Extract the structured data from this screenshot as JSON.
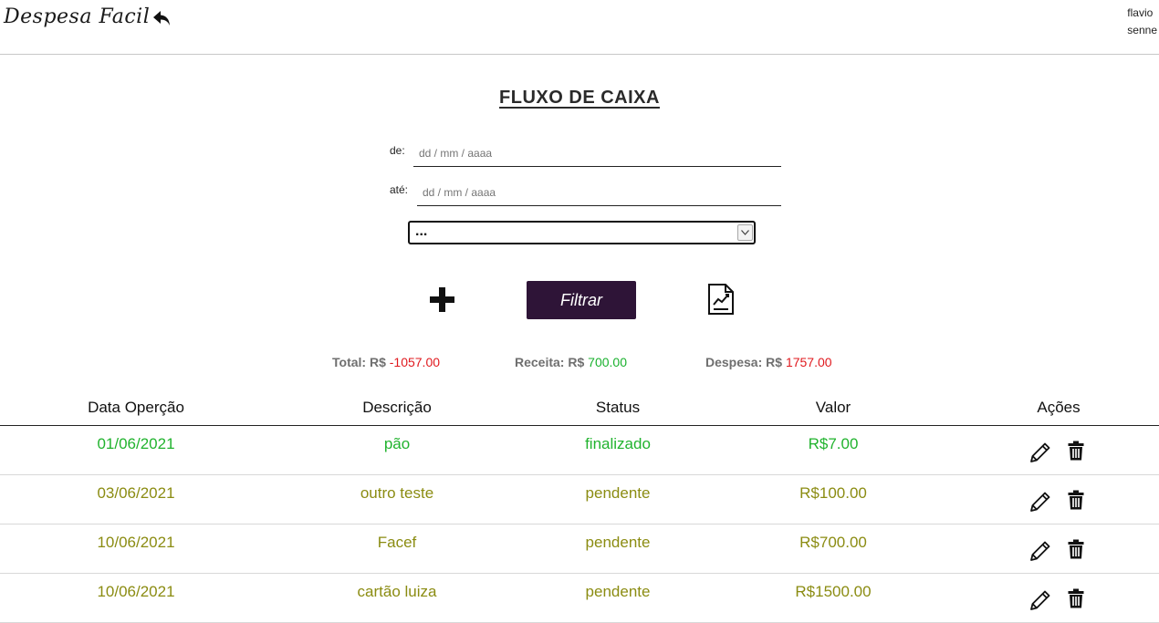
{
  "app": {
    "title": "Despesa Facil",
    "back_icon": "reply-arrow-icon"
  },
  "user": {
    "first_name": "flavio",
    "last_name": "senne"
  },
  "page": {
    "title": "FLUXO DE CAIXA"
  },
  "filters": {
    "from_label": "de:",
    "from_placeholder": "dd / mm / aaaa",
    "to_label": "até:",
    "to_placeholder": "dd / mm / aaaa",
    "select_value": "...",
    "select_icon": "chevron-down-icon"
  },
  "actions": {
    "add_icon": "plus-icon",
    "filter_label": "Filtrar",
    "report_icon": "report-chart-icon"
  },
  "totals": {
    "total_label": "Total: R$",
    "total_value": "-1057.00",
    "income_label": "Receita: R$",
    "income_value": "700.00",
    "expense_label": "Despesa: R$",
    "expense_value": "1757.00"
  },
  "table": {
    "headers": [
      "Data Operção",
      "Descrição",
      "Status",
      "Valor",
      "Ações"
    ],
    "rows": [
      {
        "date": "01/06/2021",
        "description": "pão",
        "status": "finalizado",
        "value": "R$7.00"
      },
      {
        "date": "03/06/2021",
        "description": "outro teste",
        "status": "pendente",
        "value": "R$100.00"
      },
      {
        "date": "10/06/2021",
        "description": "Facef",
        "status": "pendente",
        "value": "R$700.00"
      },
      {
        "date": "10/06/2021",
        "description": "cartão luiza",
        "status": "pendente",
        "value": "R$1500.00"
      }
    ]
  },
  "colors": {
    "header_border": "#c8c8c8",
    "filter_button": "#2e1437",
    "negative": "#e0191e",
    "positive": "#1ab12e",
    "status_done": "#21b32e",
    "status_pending": "#8b8c12"
  }
}
